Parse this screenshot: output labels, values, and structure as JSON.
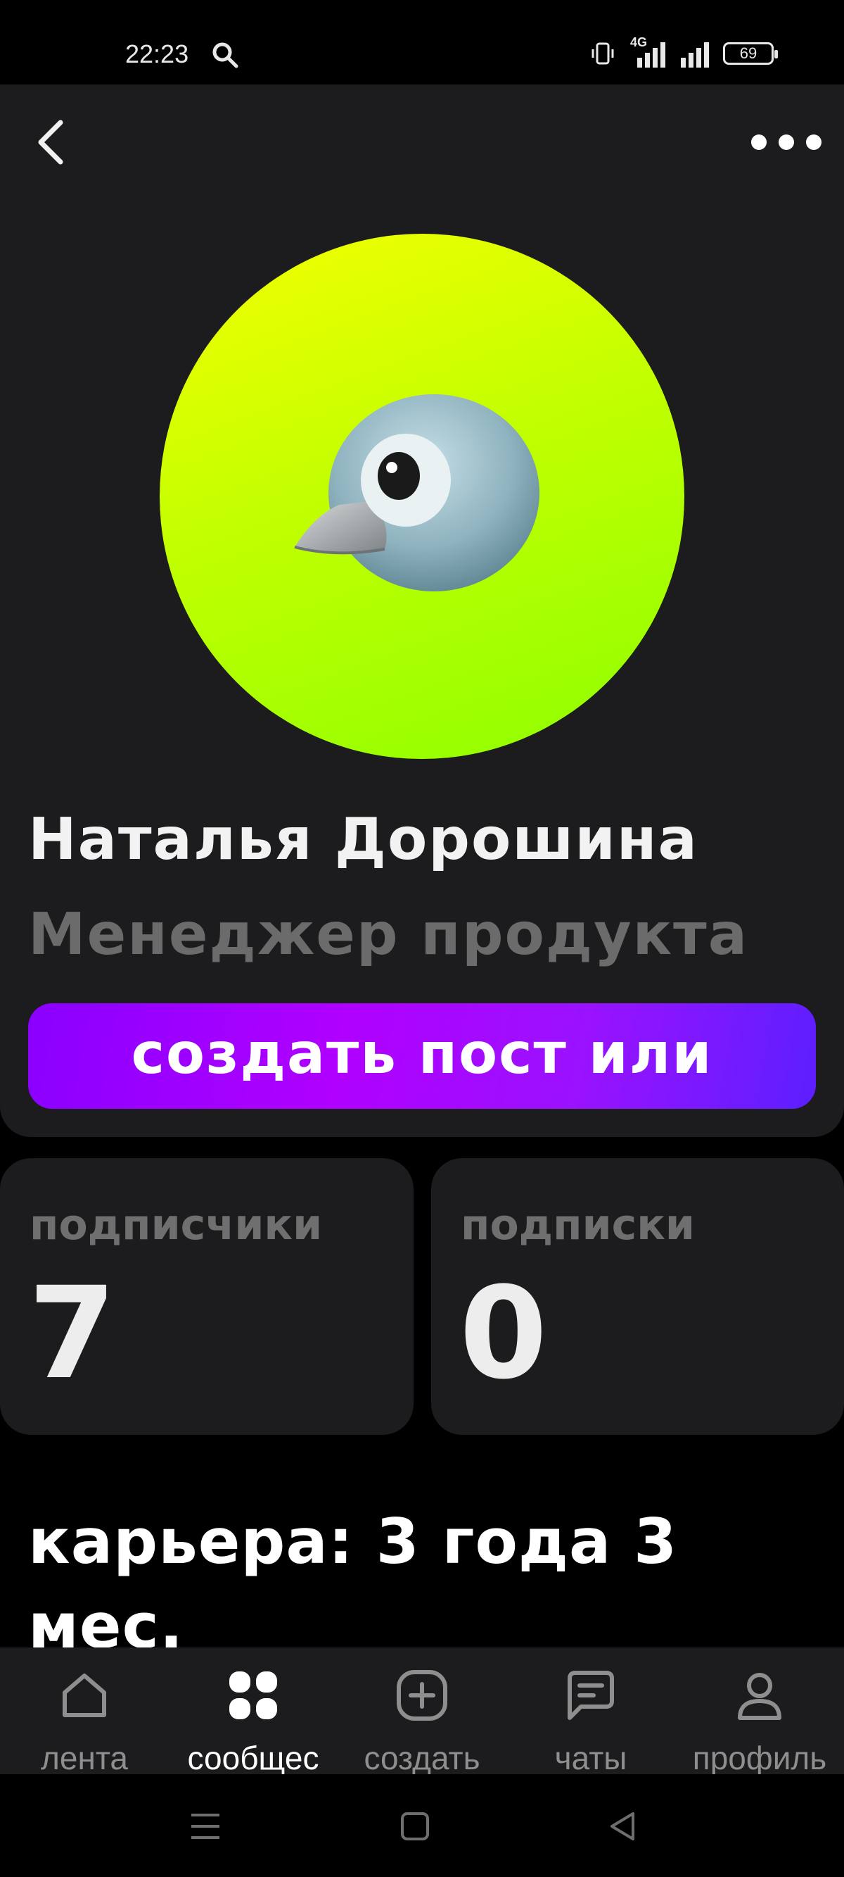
{
  "status_bar": {
    "time": "22:23",
    "network": "4G",
    "battery": "69"
  },
  "profile": {
    "name": "Наталья Дорошина",
    "position": "Менеджер продукта",
    "create_post_label": "создать пост или вопрос",
    "avatar_icon": "bird-emoji",
    "avatar_gradient": [
      "#f5ff00",
      "#8dff00"
    ]
  },
  "stats": {
    "followers_label": "подписчики",
    "followers_value": "7",
    "following_label": "подписки",
    "following_value": "0"
  },
  "career": {
    "text": "карьера: 3 года 3 мес."
  },
  "tabbar": {
    "tabs": [
      {
        "label": "лента",
        "icon": "home-icon"
      },
      {
        "label": "сообщес",
        "icon": "community-icon"
      },
      {
        "label": "создать",
        "icon": "plus-icon"
      },
      {
        "label": "чаты",
        "icon": "chat-icon"
      },
      {
        "label": "профиль",
        "icon": "profile-icon"
      }
    ],
    "active_index": 1
  },
  "colors": {
    "accent_purple": "#8a00ff",
    "background": "#000000",
    "card": "#1c1c1e"
  }
}
